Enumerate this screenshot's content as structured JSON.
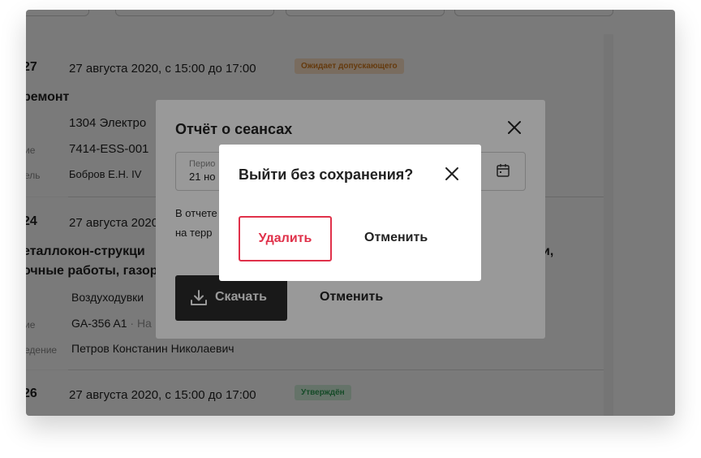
{
  "sessions": [
    {
      "number": "27",
      "datetime": "27 августа 2020, с 15:00 до 17:00",
      "status": "Ожидает допускающего",
      "title": "ремонт",
      "fields": [
        {
          "label": "ие",
          "value": "1304 Электро"
        },
        {
          "label": "ие",
          "value": "7414-ESS-001"
        },
        {
          "label": "ель",
          "value": "Бобров Е.Н. IV"
        }
      ]
    },
    {
      "number": "24",
      "datetime": "27 августа 2020",
      "title_line1": "еталлокон-струкци",
      "title_line1_tail": "и,",
      "title_line2": "очные работы, газор",
      "fields": [
        {
          "label": "",
          "value": "Воздуходувки"
        },
        {
          "label": "ие",
          "value": "GA-356 A1",
          "value_tail": " · На"
        },
        {
          "label": "едение",
          "value": "Петров Констанин Николаевич"
        }
      ]
    },
    {
      "number": "26",
      "datetime": "27 августа 2020, с 15:00 до 17:00",
      "status": "Утверждён"
    }
  ],
  "report_modal": {
    "title": "Отчёт о сеансах",
    "period_label": "Перио",
    "period_value": "21 но",
    "text_line1": "В отчете",
    "text_line2": "на терр",
    "download_label": "Скачать",
    "cancel_label": "Отменить",
    "icons": [
      "close-icon",
      "calendar-icon",
      "download-icon"
    ]
  },
  "exit_dialog": {
    "title": "Выйти без сохранения?",
    "delete_label": "Удалить",
    "cancel_label": "Отменить",
    "close_icon": "close-icon"
  },
  "colors": {
    "danger": "#e0314a",
    "pending_badge_bg": "#fde3c6",
    "pending_badge_text": "#d27a1f",
    "approved_badge_bg": "#d4f0dc",
    "approved_badge_text": "#2f9d54",
    "dark_button": "#2b2b2b"
  }
}
